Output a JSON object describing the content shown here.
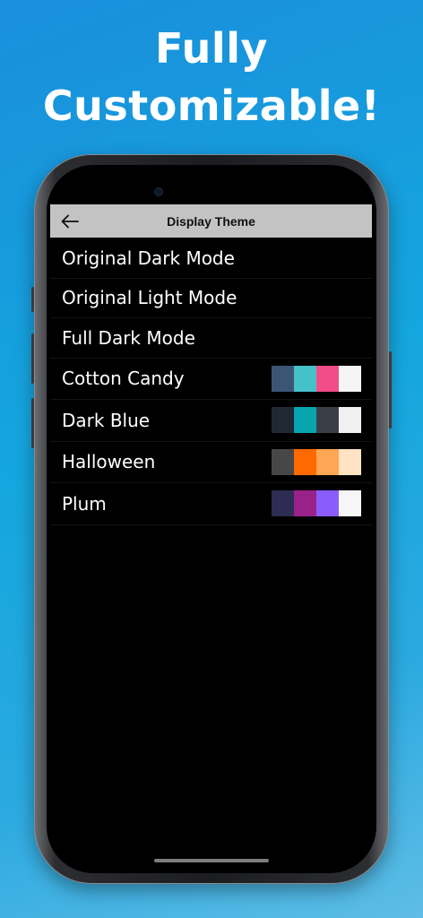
{
  "headline": {
    "line1": "Fully",
    "line2": "Customizable!"
  },
  "appbar": {
    "title": "Display Theme",
    "back_icon": "arrow-left-icon"
  },
  "themes": [
    {
      "label": "Original Dark Mode",
      "colors": []
    },
    {
      "label": "Original Light Mode",
      "colors": []
    },
    {
      "label": "Full Dark Mode",
      "colors": []
    },
    {
      "label": "Cotton Candy",
      "colors": [
        "#3c5575",
        "#45c2c9",
        "#f24d86",
        "#f5f5f5"
      ]
    },
    {
      "label": "Dark Blue",
      "colors": [
        "#212833",
        "#07a5ad",
        "#3a3f47",
        "#f0f0f0"
      ]
    },
    {
      "label": "Halloween",
      "colors": [
        "#474747",
        "#ff6a00",
        "#ffa554",
        "#ffe3c2"
      ]
    },
    {
      "label": "Plum",
      "colors": [
        "#2e2c52",
        "#99228a",
        "#8a5cfa",
        "#f6f6f8"
      ]
    }
  ]
}
